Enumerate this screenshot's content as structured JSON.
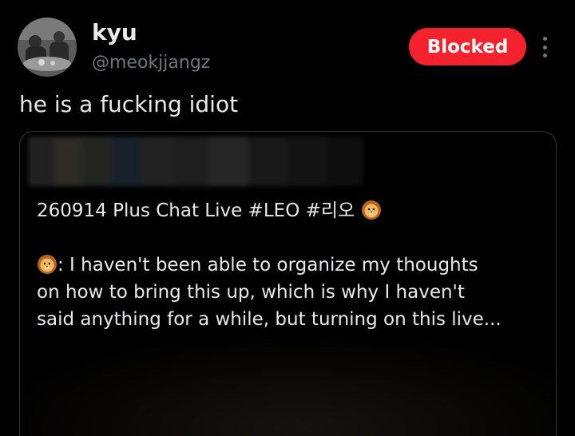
{
  "author": {
    "display_name": "kyu",
    "handle": "@meokjjangz"
  },
  "actions": {
    "blocked_label": "Blocked",
    "more_icon": "more-vertical-icon"
  },
  "tweet": {
    "text": "he is a fucking idiot"
  },
  "quote": {
    "line1_text": "260914 Plus Chat Live #LEO  #리오",
    "line2_text": ": I haven't been able to organize my thoughts",
    "line3_text": "on how to bring this up, which is why I haven't",
    "line4_text": "said anything for a while, but turning on this live...",
    "emoji_icon": "lion-face-icon"
  },
  "colors": {
    "background": "#000000",
    "blocked_button": "#f4212e",
    "primary_text": "#e7e9ea",
    "secondary_text": "#71767b",
    "card_border": "#333639"
  }
}
